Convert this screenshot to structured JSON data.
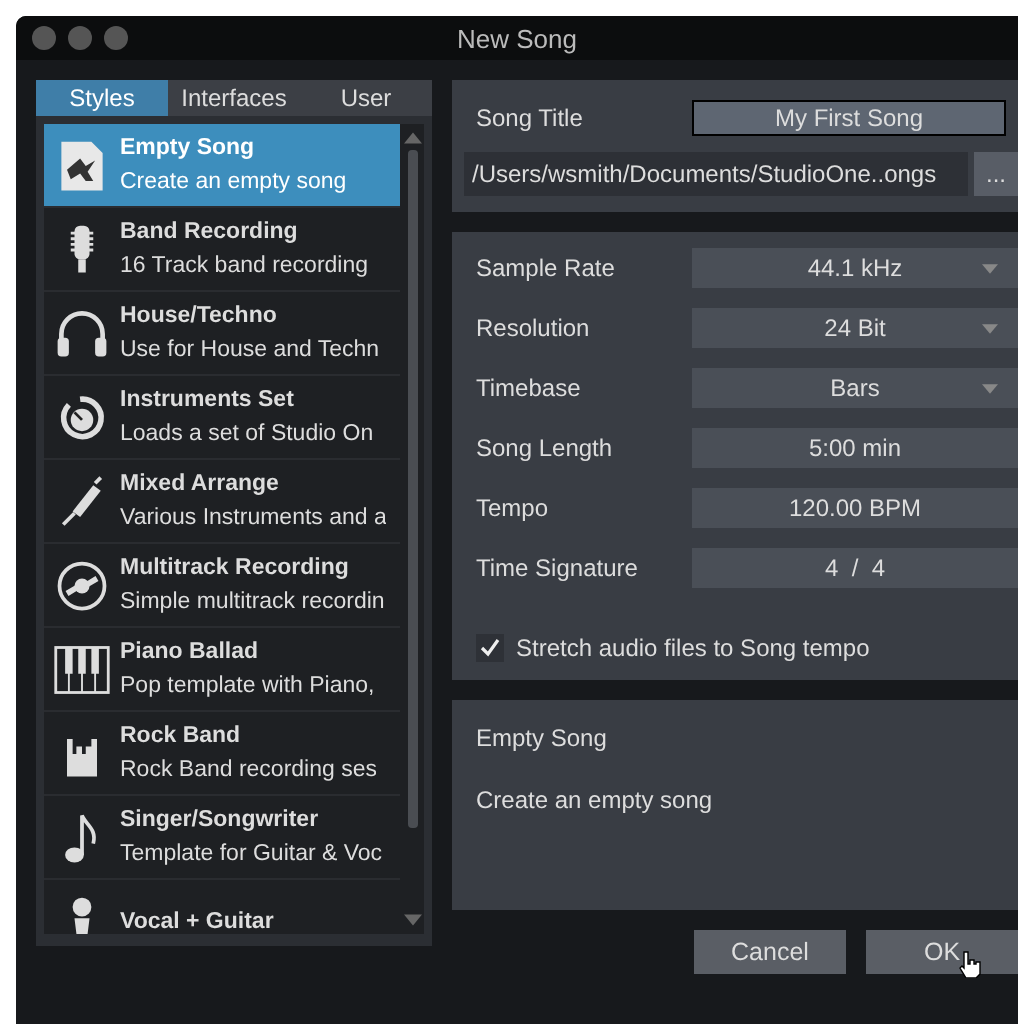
{
  "window": {
    "title": "New Song"
  },
  "tabs": [
    {
      "label": "Styles",
      "selected": true
    },
    {
      "label": "Interfaces",
      "selected": false
    },
    {
      "label": "User",
      "selected": false
    }
  ],
  "templates": [
    {
      "kind": "empty",
      "name": "Empty Song",
      "description": "Create an empty song",
      "selected": true
    },
    {
      "kind": "microphone",
      "name": "Band Recording",
      "description": "16 Track band recording",
      "selected": false
    },
    {
      "kind": "headphones",
      "name": "House/Techno",
      "description": "Use for House and Techn",
      "selected": false
    },
    {
      "kind": "knob",
      "name": "Instruments Set",
      "description": "Loads a set of  Studio On",
      "selected": false
    },
    {
      "kind": "cable",
      "name": "Mixed Arrange",
      "description": "Various Instruments and a",
      "selected": false
    },
    {
      "kind": "disc",
      "name": "Multitrack Recording",
      "description": "Simple multitrack recordin",
      "selected": false
    },
    {
      "kind": "piano",
      "name": "Piano Ballad",
      "description": "Pop template with Piano,",
      "selected": false
    },
    {
      "kind": "hand",
      "name": "Rock Band",
      "description": "Rock Band recording ses",
      "selected": false
    },
    {
      "kind": "note",
      "name": "Singer/Songwriter",
      "description": "Template for Guitar & Voc",
      "selected": false
    },
    {
      "kind": "handmic",
      "name": "Vocal + Guitar",
      "selected": false
    }
  ],
  "song_title": {
    "label": "Song Title",
    "value": "My First Song"
  },
  "path": {
    "value": "/Users/wsmith/Documents/StudioOne..ongs",
    "browse_label": "..."
  },
  "settings": [
    {
      "kind": "dropdown",
      "label": "Sample Rate",
      "value": "44.1 kHz"
    },
    {
      "kind": "dropdown",
      "label": "Resolution",
      "value": "24 Bit"
    },
    {
      "kind": "dropdown",
      "label": "Timebase",
      "value": "Bars"
    },
    {
      "kind": "value",
      "label": "Song Length",
      "value": "5:00 min"
    },
    {
      "kind": "value",
      "label": "Tempo",
      "value": "120.00 BPM"
    },
    {
      "kind": "value",
      "label": "Time Signature",
      "value": "4  /  4"
    }
  ],
  "stretch": {
    "label": "Stretch audio files to Song tempo",
    "checked": true
  },
  "info": {
    "title": "Empty Song",
    "description": "Create an empty song"
  },
  "buttons": [
    "Cancel",
    "OK"
  ]
}
